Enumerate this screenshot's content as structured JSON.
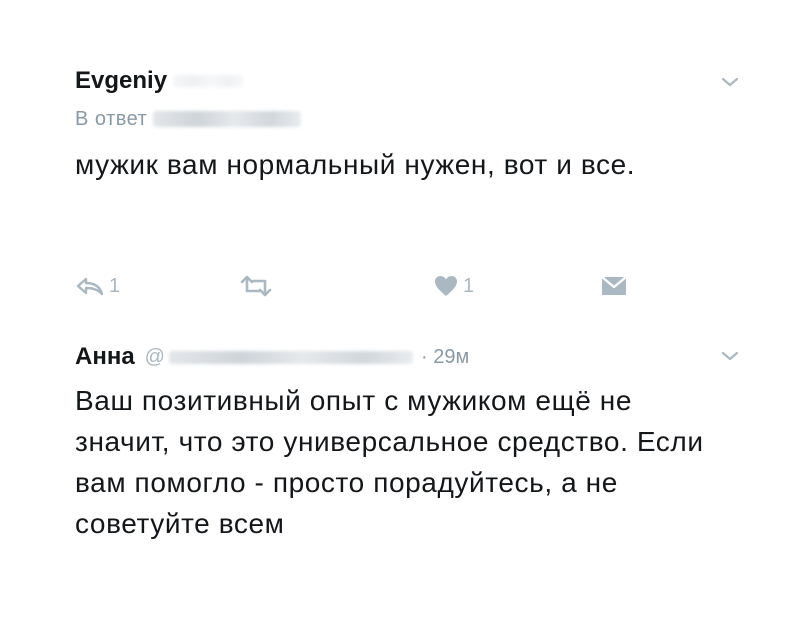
{
  "tweets": [
    {
      "author": "Evgeniy",
      "reply_to_label": "В ответ",
      "text": "мужик вам нормальный нужен, вот и все.",
      "actions": {
        "reply_count": "1",
        "like_count": "1"
      }
    },
    {
      "author": "Анна",
      "handle_prefix": "@",
      "timestamp": "· 29м",
      "text": "Ваш позитивный опыт с мужиком ещё не значит, что это универсальное средство. Если вам помогло - просто порадуйтесь, а не советуйте всем"
    }
  ],
  "icons": {
    "reply": "reply-icon",
    "retweet": "retweet-icon",
    "like": "heart-icon",
    "dm": "envelope-icon",
    "more": "chevron-down-icon"
  },
  "colors": {
    "text": "#14171a",
    "secondary": "#8899a6",
    "icon": "#aab8c2",
    "background": "#ffffff"
  }
}
